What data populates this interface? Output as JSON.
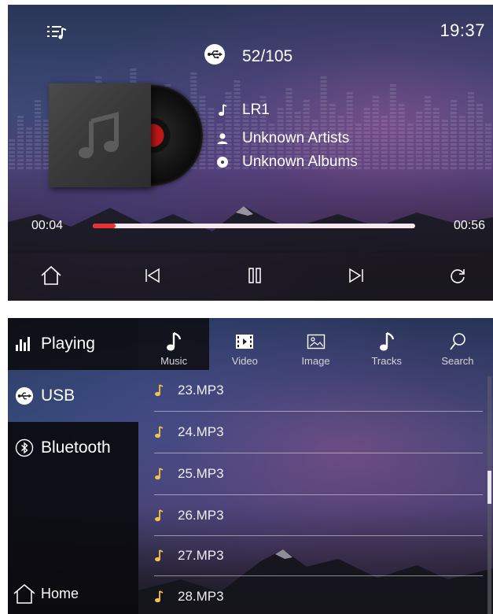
{
  "colors": {
    "accent": "#e53333",
    "progress_track": "#f3e9ef",
    "text": "#ffffff"
  },
  "player": {
    "clock": "19:37",
    "source_icon": "usb-icon",
    "track_counter": "52/105",
    "track_name": "LR1",
    "artist": "Unknown Artists",
    "album": "Unknown Albums",
    "time_current": "00:04",
    "time_total": "00:56",
    "progress": 0.07,
    "controls": [
      {
        "name": "home-button",
        "icon": "home-icon"
      },
      {
        "name": "previous-button",
        "icon": "skip-previous-icon"
      },
      {
        "name": "pause-button",
        "icon": "pause-icon"
      },
      {
        "name": "next-button",
        "icon": "skip-next-icon"
      },
      {
        "name": "repeat-button",
        "icon": "repeat-icon"
      }
    ]
  },
  "browser": {
    "sidebar": {
      "playing": "Playing",
      "usb": "USB",
      "bluetooth": "Bluetooth",
      "home": "Home"
    },
    "tabs": [
      {
        "label": "Music",
        "icon": "music-note-icon",
        "active": true
      },
      {
        "label": "Video",
        "icon": "film-icon",
        "active": false
      },
      {
        "label": "Image",
        "icon": "image-icon",
        "active": false
      },
      {
        "label": "Tracks",
        "icon": "music-note-icon",
        "active": false
      },
      {
        "label": "Search",
        "icon": "search-icon",
        "active": false
      }
    ],
    "tracks": [
      "23.MP3",
      "24.MP3",
      "25.MP3",
      "26.MP3",
      "27.MP3",
      "28.MP3"
    ]
  }
}
